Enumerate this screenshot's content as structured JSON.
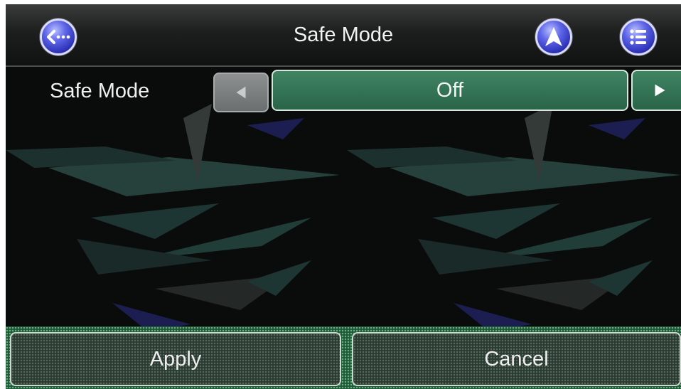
{
  "header": {
    "title": "Safe Mode",
    "back_icon": "back-arrow-icon",
    "navigation_icon": "navigation-arrow-icon",
    "menu_icon": "menu-list-icon"
  },
  "setting": {
    "label": "Safe Mode",
    "value": "Off",
    "prev_icon": "triangle-left-icon",
    "next_icon": "triangle-right-icon"
  },
  "footer": {
    "apply_label": "Apply",
    "cancel_label": "Cancel"
  },
  "colors": {
    "accent_blue": "#4b52d6",
    "selector_green": "#2f6e50",
    "footer_green": "#1f5a36"
  }
}
